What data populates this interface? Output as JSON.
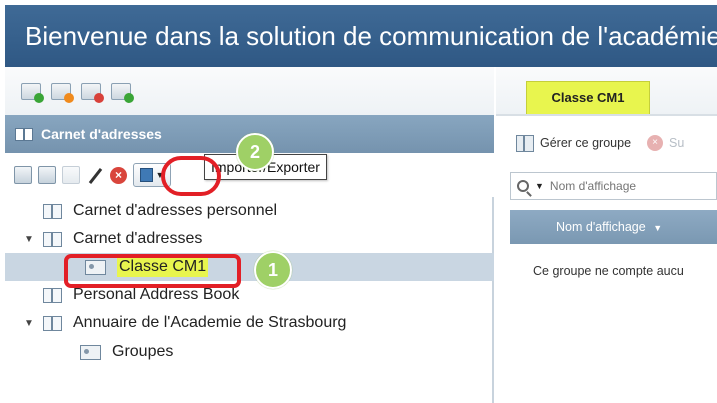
{
  "window": {
    "title": "Bienvenue dans la solution de communication de l'académie"
  },
  "left_panel": {
    "section_title": "Carnet d'adresses",
    "tooltip": "Importer/Exporter",
    "tree": [
      {
        "label": "Carnet d'adresses personnel",
        "expanded": null
      },
      {
        "label": "Carnet d'adresses",
        "expanded": true
      },
      {
        "label": "Classe CM1",
        "selected": true
      },
      {
        "label": "Personal Address Book",
        "expanded": null
      },
      {
        "label": "Annuaire de l'Academie de Strasbourg",
        "expanded": true
      },
      {
        "label": "Groupes"
      }
    ],
    "annotations": {
      "step1": "1",
      "step2": "2"
    }
  },
  "right_panel": {
    "tab_label": "Classe CM1",
    "manage_group_label": "Gérer ce groupe",
    "delete_label_partial": "Su",
    "search_placeholder": "Nom d'affichage",
    "column_header": "Nom d'affichage",
    "empty_message": "Ce groupe ne compte aucu"
  },
  "colors": {
    "title_bar": "#3f6a96",
    "section_header": "#7f9db7",
    "highlight": "#e8f54e",
    "annotation_ring": "#e21f26",
    "annotation_circle": "#9fd066"
  }
}
